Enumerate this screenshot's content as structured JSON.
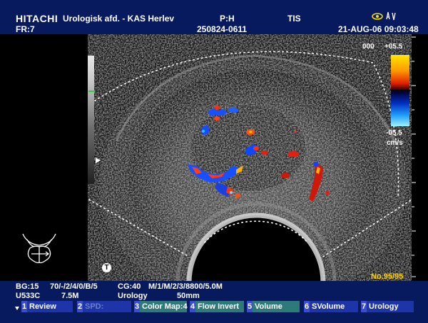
{
  "header": {
    "logo": "HITACHI",
    "frame": "FR:7",
    "site": "Urologisk afd. - KAS Herlev",
    "patient_label": "P:H",
    "patient_id": "250824-0611",
    "tis": "TIS",
    "datetime": "21-AUG-06 09:03:48"
  },
  "color_scale": {
    "top_label": "000",
    "max": "+05.5",
    "min": "-05.5",
    "unit": "cm/s"
  },
  "frame_counter": "No.95/95",
  "params": {
    "row1": [
      "BG:15",
      "70/-/2/4/0/B/5",
      "CG:40",
      "M/1/M/2/3/8800/5.0M"
    ],
    "row2": [
      "U533C",
      "7.5M",
      "Urology",
      "50mm"
    ]
  },
  "fkeys": [
    {
      "num": "1",
      "label": "Review"
    },
    {
      "num": "2",
      "label": "SPD:"
    },
    {
      "num": "3",
      "label": "Color Map:4"
    },
    {
      "num": "4",
      "label": "Flow Invert"
    },
    {
      "num": "5",
      "label": "Volume"
    },
    {
      "num": "6",
      "label": "SVolume"
    },
    {
      "num": "7",
      "label": "Urology"
    }
  ],
  "icons": [
    "eye-icon",
    "probe-orientation-icon",
    "grey-scale-bar",
    "color-velocity-bar"
  ]
}
